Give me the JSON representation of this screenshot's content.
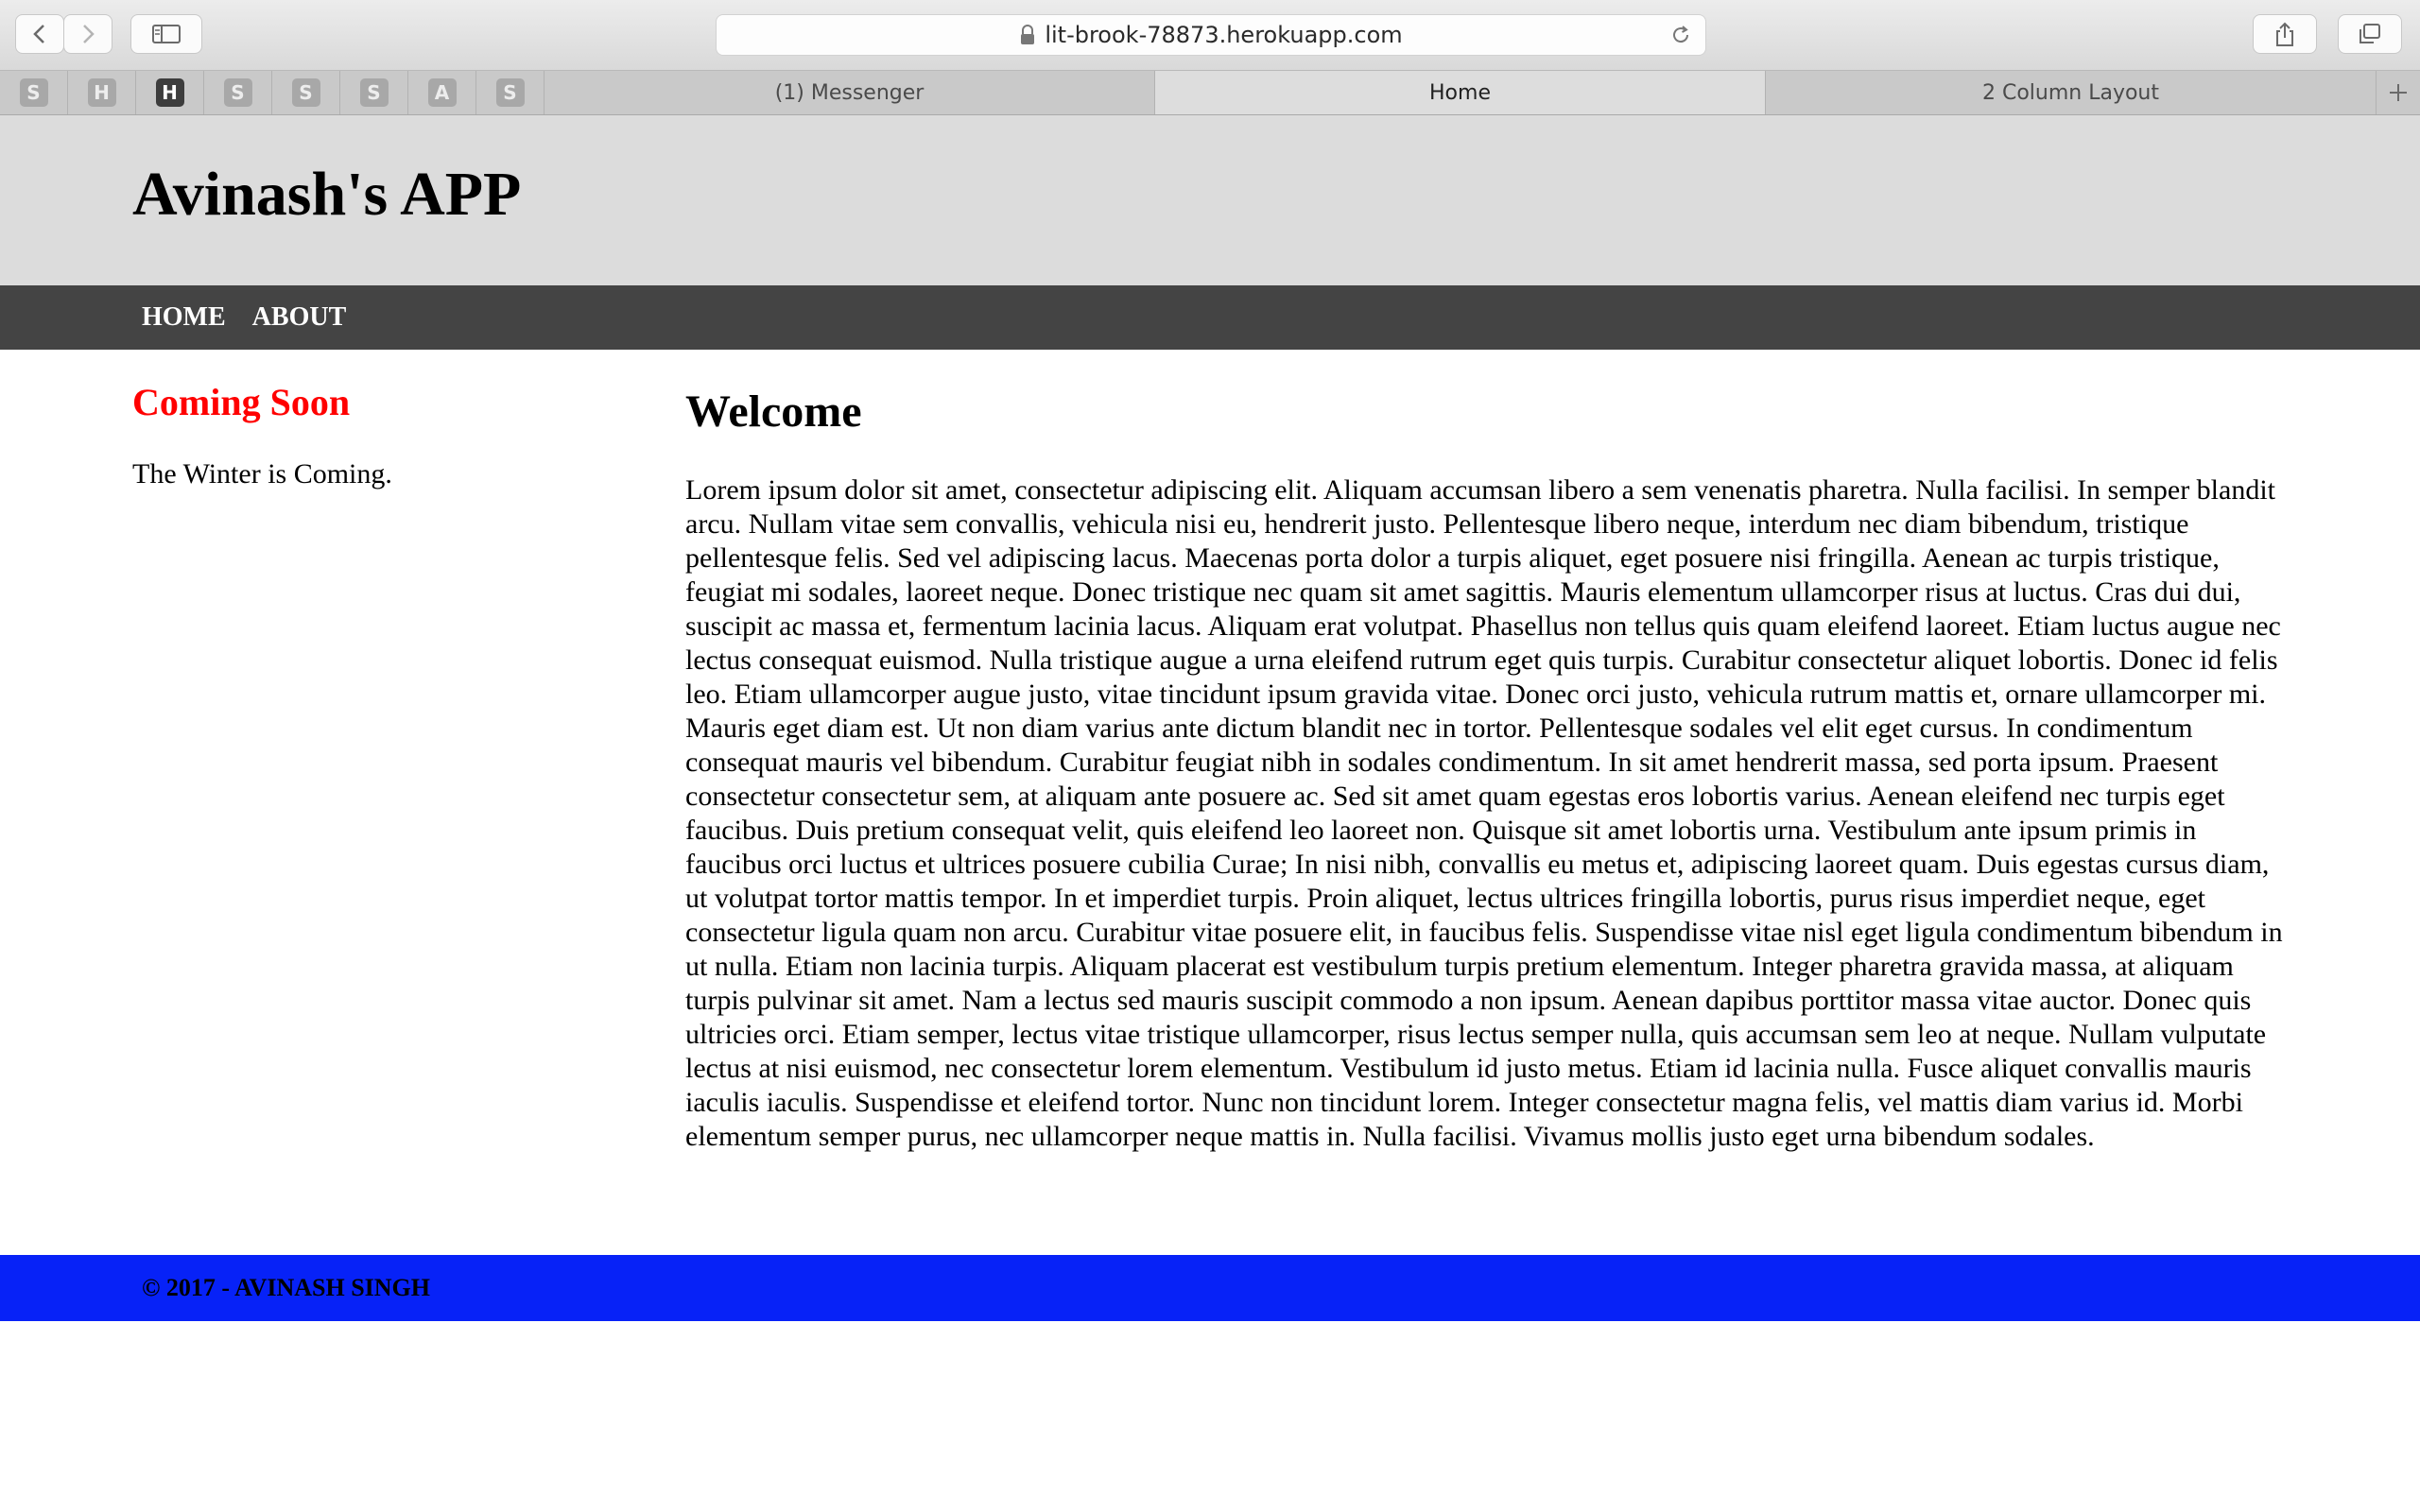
{
  "browser": {
    "url": "lit-brook-78873.herokuapp.com",
    "pinned_tabs": [
      {
        "letter": "S",
        "active": false
      },
      {
        "letter": "H",
        "active": false
      },
      {
        "letter": "H",
        "active": true
      },
      {
        "letter": "S",
        "active": false
      },
      {
        "letter": "S",
        "active": false
      },
      {
        "letter": "S",
        "active": false
      },
      {
        "letter": "A",
        "active": false
      },
      {
        "letter": "S",
        "active": false
      }
    ],
    "tabs": [
      {
        "label": "(1) Messenger",
        "active": false
      },
      {
        "label": "Home",
        "active": true
      },
      {
        "label": "2 Column Layout",
        "active": false
      }
    ]
  },
  "site": {
    "title": "Avinash's APP",
    "nav": [
      "HOME",
      "ABOUT"
    ]
  },
  "sidebar": {
    "title": "Coming Soon",
    "text": "The Winter is Coming."
  },
  "main": {
    "title": "Welcome",
    "body": "Lorem ipsum dolor sit amet, consectetur adipiscing elit. Aliquam accumsan libero a sem venenatis pharetra. Nulla facilisi. In semper blandit arcu. Nullam vitae sem convallis, vehicula nisi eu, hendrerit justo. Pellentesque libero neque, interdum nec diam bibendum, tristique pellentesque felis. Sed vel adipiscing lacus. Maecenas porta dolor a turpis aliquet, eget posuere nisi fringilla. Aenean ac turpis tristique, feugiat mi sodales, laoreet neque. Donec tristique nec quam sit amet sagittis. Mauris elementum ullamcorper risus at luctus. Cras dui dui, suscipit ac massa et, fermentum lacinia lacus. Aliquam erat volutpat. Phasellus non tellus quis quam eleifend laoreet. Etiam luctus augue nec lectus consequat euismod. Nulla tristique augue a urna eleifend rutrum eget quis turpis. Curabitur consectetur aliquet lobortis. Donec id felis leo. Etiam ullamcorper augue justo, vitae tincidunt ipsum gravida vitae. Donec orci justo, vehicula rutrum mattis et, ornare ullamcorper mi. Mauris eget diam est. Ut non diam varius ante dictum blandit nec in tortor. Pellentesque sodales vel elit eget cursus. In condimentum consequat mauris vel bibendum. Curabitur feugiat nibh in sodales condimentum. In sit amet hendrerit massa, sed porta ipsum. Praesent consectetur consectetur sem, at aliquam ante posuere ac. Sed sit amet quam egestas eros lobortis varius. Aenean eleifend nec turpis eget faucibus. Duis pretium consequat velit, quis eleifend leo laoreet non. Quisque sit amet lobortis urna. Vestibulum ante ipsum primis in faucibus orci luctus et ultrices posuere cubilia Curae; In nisi nibh, convallis eu metus et, adipiscing laoreet quam. Duis egestas cursus diam, ut volutpat tortor mattis tempor. In et imperdiet turpis. Proin aliquet, lectus ultrices fringilla lobortis, purus risus imperdiet neque, eget consectetur ligula quam non arcu. Curabitur vitae posuere elit, in faucibus felis. Suspendisse vitae nisl eget ligula condimentum bibendum in ut nulla. Etiam non lacinia turpis. Aliquam placerat est vestibulum turpis pretium elementum. Integer pharetra gravida massa, at aliquam turpis pulvinar sit amet. Nam a lectus sed mauris suscipit commodo a non ipsum. Aenean dapibus porttitor massa vitae auctor. Donec quis ultricies orci. Etiam semper, lectus vitae tristique ullamcorper, risus lectus semper nulla, quis accumsan sem leo at neque. Nullam vulputate lectus at nisi euismod, nec consectetur lorem elementum. Vestibulum id justo metus. Etiam id lacinia nulla. Fusce aliquet convallis mauris iaculis iaculis. Suspendisse et eleifend tortor. Nunc non tincidunt lorem. Integer consectetur magna felis, vel mattis diam varius id. Morbi elementum semper purus, nec ullamcorper neque mattis in. Nulla facilisi. Vivamus mollis justo eget urna bibendum sodales."
  },
  "footer": {
    "text": "© 2017 - AVINASH SINGH"
  },
  "colors": {
    "sidebar_title": "#ff0000",
    "navbar": "#444444",
    "header": "#dcdcdc",
    "footer": "#0722f7"
  }
}
